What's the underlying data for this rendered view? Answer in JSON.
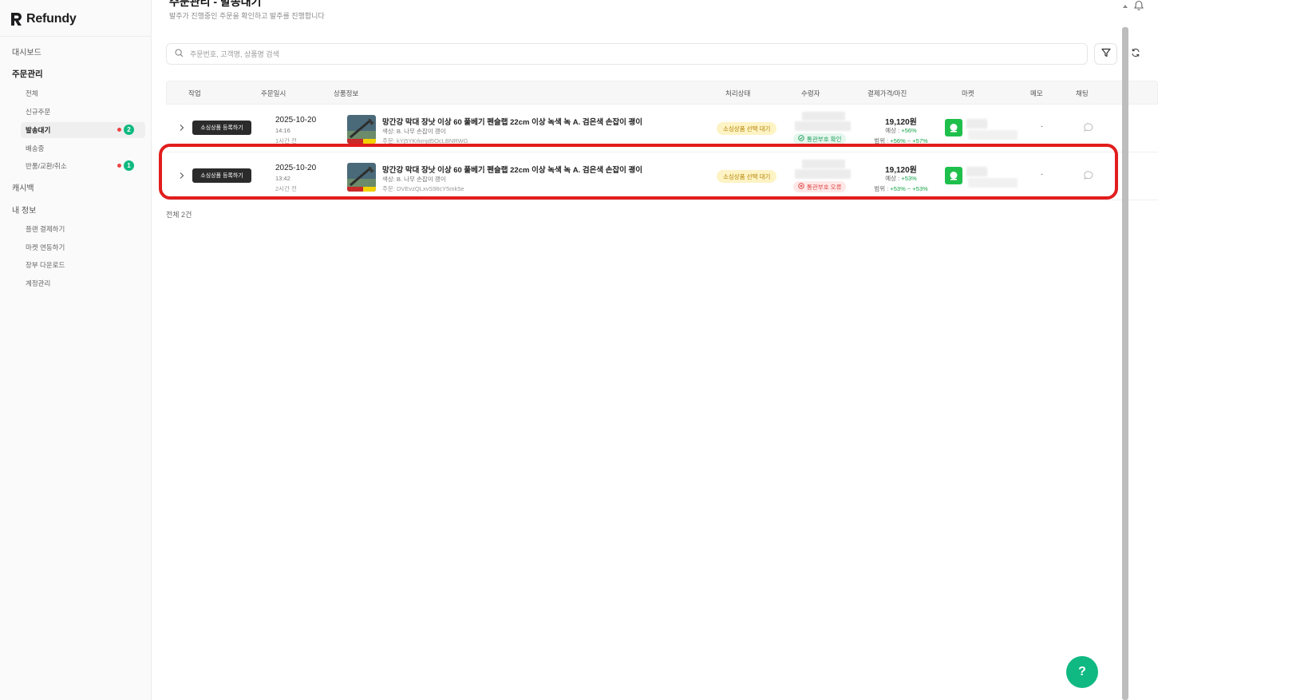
{
  "brand": {
    "name": "Refundy"
  },
  "sidebar": {
    "items": [
      {
        "label": "대시보드"
      },
      {
        "label": "주문관리"
      },
      {
        "label": "전체"
      },
      {
        "label": "신규주문"
      },
      {
        "label": "발송대기",
        "badge": "2"
      },
      {
        "label": "배송중"
      },
      {
        "label": "반품/교환/취소",
        "badge": "1"
      },
      {
        "label": "캐시백"
      },
      {
        "label": "내 정보"
      },
      {
        "label": "플랜 결제하기"
      },
      {
        "label": "마켓 연동하기"
      },
      {
        "label": "장부 다운로드"
      },
      {
        "label": "계정관리"
      }
    ]
  },
  "header": {
    "title": "주문관리 - 발송대기",
    "subtitle": "발주가 진행중인 주문을 확인하고 발주를 진행합니다"
  },
  "search": {
    "placeholder": "주문번호, 고객명, 상품명 검색",
    "value": ""
  },
  "table": {
    "headers": [
      "작업",
      "주문일시",
      "상품정보",
      "처리상태",
      "수령자",
      "결제가격/마진",
      "마켓",
      "메모",
      "채팅"
    ],
    "rows": [
      {
        "action": "소싱상품 등록하기",
        "date": "2025-10-20",
        "time": "14:16",
        "ago": "1시간 전",
        "product_name": "망간강 막대 장낫 이상 60 풀베기 펜슬랩 22cm 이상 녹색 녹 A. 검은색 손잡이 괭이",
        "option": "색상: B. 나무 손잡이 괭이",
        "order_no": "주문: kYj5YKrkmjd5OcLBNRWG",
        "status": "소싱상품 선택 대기",
        "customs": "통관부호 확인",
        "customs_ok": true,
        "price": "19,120원",
        "expected_label": "예상 : ",
        "expected": "+56%",
        "range_label": "범위 : ",
        "range": "+56% ~ +57%",
        "memo": "-"
      },
      {
        "action": "소싱상품 등록하기",
        "date": "2025-10-20",
        "time": "13:42",
        "ago": "2시간 전",
        "product_name": "망간강 막대 장낫 이상 60 풀베기 펜슬랩 22cm 이상 녹색 녹 A. 검은색 손잡이 괭이",
        "option": "색상: B. 나무 손잡이 괭이",
        "order_no": "주문: DVEvzQLxvS9ltcY5mk5e",
        "status": "소싱상품 선택 대기",
        "customs": "통관부호 오류",
        "customs_ok": false,
        "price": "19,120원",
        "expected_label": "예상 : ",
        "expected": "+53%",
        "range_label": "범위 : ",
        "range": "+53% ~ +53%",
        "memo": "-"
      }
    ],
    "total": "전체 2건"
  },
  "colors": {
    "accent": "#10b981",
    "highlight": "#e11d1d",
    "warning_bg": "#fdf3c4",
    "error": "#e0413e",
    "success": "#16a34a"
  }
}
